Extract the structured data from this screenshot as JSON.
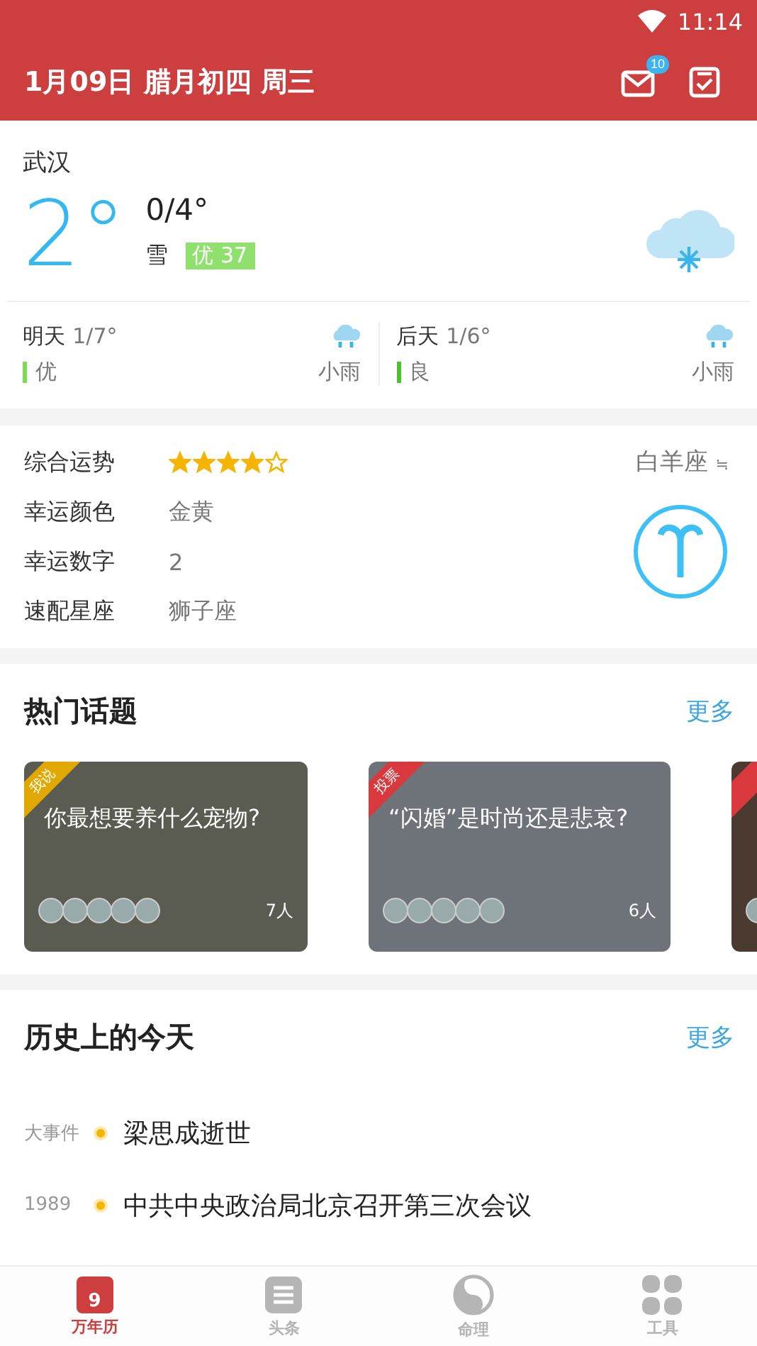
{
  "status_bar": {
    "time": "11:14"
  },
  "header": {
    "date": "1月09日 腊月初四 周三",
    "mail_badge": "10"
  },
  "weather": {
    "city": "武汉",
    "temp": "2°",
    "range": "0/4°",
    "condition": "雪",
    "aqi": "优 37",
    "forecast": [
      {
        "day": "明天",
        "range": "1/7°",
        "quality": "优",
        "color": "#7ed957",
        "condition": "小雨"
      },
      {
        "day": "后天",
        "range": "1/6°",
        "quality": "良",
        "color": "#4cc12c",
        "condition": "小雨"
      }
    ]
  },
  "horoscope": {
    "sign": "白羊座",
    "switch": "≒",
    "rows": [
      {
        "label": "综合运势",
        "kind": "stars",
        "stars": 4
      },
      {
        "label": "幸运颜色",
        "kind": "text",
        "value": "金黄"
      },
      {
        "label": "幸运数字",
        "kind": "text",
        "value": "2"
      },
      {
        "label": "速配星座",
        "kind": "text",
        "value": "狮子座"
      }
    ]
  },
  "topics": {
    "title": "热门话题",
    "more": "更多",
    "items": [
      {
        "tag": "我说",
        "color": "#e0a800",
        "title": "你最想要养什么宠物?",
        "count": "7人"
      },
      {
        "tag": "投票",
        "color": "#d9393c",
        "title": "“闪婚”是时尚还是悲哀?",
        "count": "6人"
      },
      {
        "color": "#d9393c"
      }
    ]
  },
  "history": {
    "title": "历史上的今天",
    "more": "更多",
    "items": [
      {
        "year": "大事件",
        "event": "梁思成逝世"
      },
      {
        "year": "1989",
        "event": "中共中央政治局北京召开第三次会议"
      }
    ]
  },
  "tabs": [
    {
      "label": "万年历",
      "badge": "9",
      "selected": true
    },
    {
      "label": "头条",
      "selected": false
    },
    {
      "label": "命理",
      "selected": false
    },
    {
      "label": "工具",
      "selected": false
    }
  ]
}
